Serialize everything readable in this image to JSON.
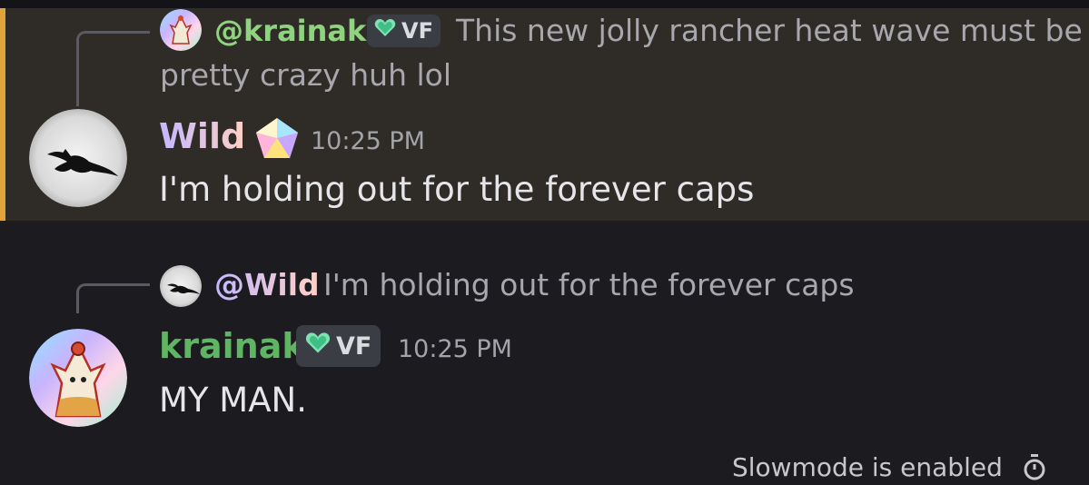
{
  "colors": {
    "background": "#1b1b20",
    "highlight_background": "#2f2b27",
    "highlight_bar": "#e0a43a",
    "krainak_name": "#5fb662",
    "krainak_mention": "#8fd27f",
    "wild_gradient_start": "#c3b8ff",
    "wild_gradient_end": "#ffd0c4",
    "muted_text": "#a7a7ad"
  },
  "messages": [
    {
      "reply": {
        "mention": "@krainak",
        "badge": "VF",
        "badge_icon": "heart-icon",
        "text_line1": "This new jolly rancher heat wave must be",
        "text_line2": "pretty crazy huh lol"
      },
      "author": "Wild",
      "author_badge_icon": "pentagon-gem-icon",
      "time": "10:25 PM",
      "content": "I'm holding out for the forever caps",
      "highlighted": true
    },
    {
      "reply": {
        "mention": "@Wild",
        "text": "I'm holding out for the forever caps"
      },
      "author": "krainak",
      "badge": "VF",
      "badge_icon": "heart-icon",
      "time": "10:25 PM",
      "content": "MY MAN.",
      "highlighted": false
    }
  ],
  "footer": {
    "slowmode_text": "Slowmode is enabled",
    "icon": "stopwatch-icon"
  }
}
